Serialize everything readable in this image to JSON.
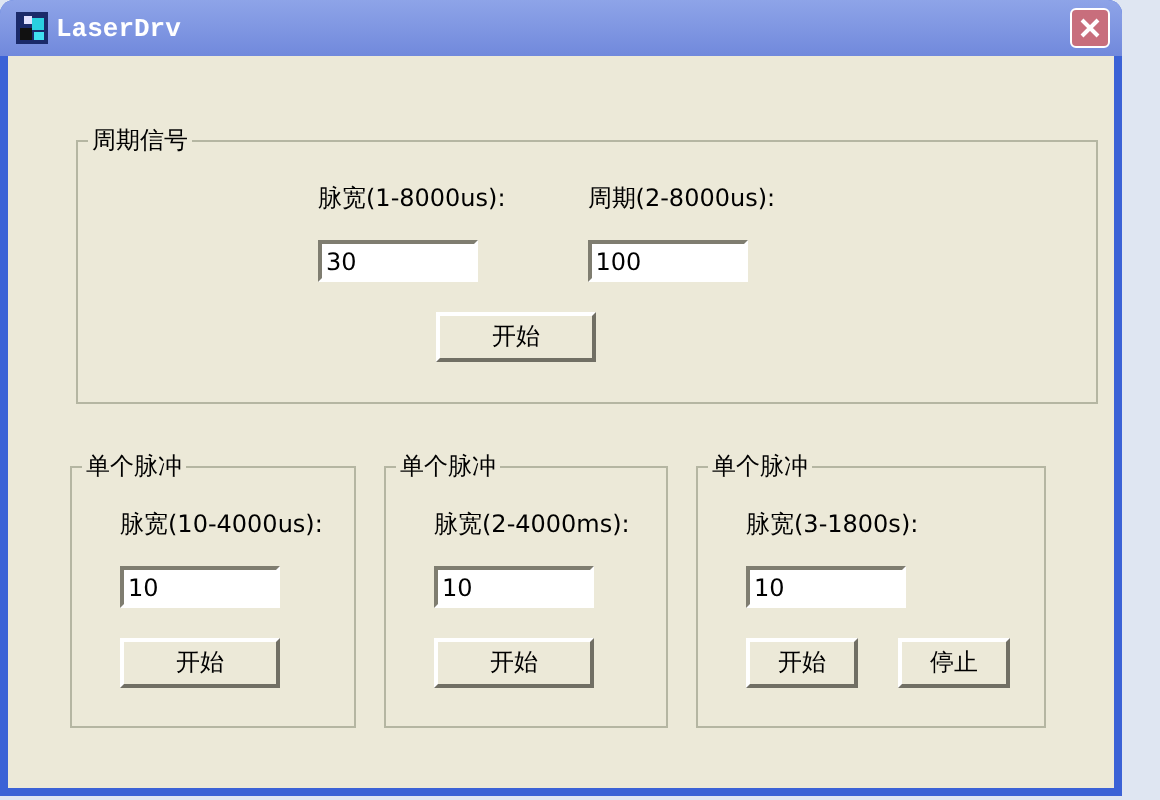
{
  "window": {
    "title": "LaserDrv"
  },
  "periodic_group": {
    "title": "周期信号",
    "fields": [
      {
        "label": "脉宽(1-8000us):",
        "value": "30"
      },
      {
        "label": "周期(2-8000us):",
        "value": "100"
      }
    ],
    "buttons": [
      "开始"
    ]
  },
  "single_pulse_groups": [
    {
      "title": "单个脉冲",
      "label": "脉宽(10-4000us):",
      "value": "10",
      "buttons": [
        "开始"
      ]
    },
    {
      "title": "单个脉冲",
      "label": "脉宽(2-4000ms):",
      "value": "10",
      "buttons": [
        "开始"
      ]
    },
    {
      "title": "单个脉冲",
      "label": "脉宽(3-1800s):",
      "value": "10",
      "buttons": [
        "开始",
        "停止"
      ]
    }
  ]
}
